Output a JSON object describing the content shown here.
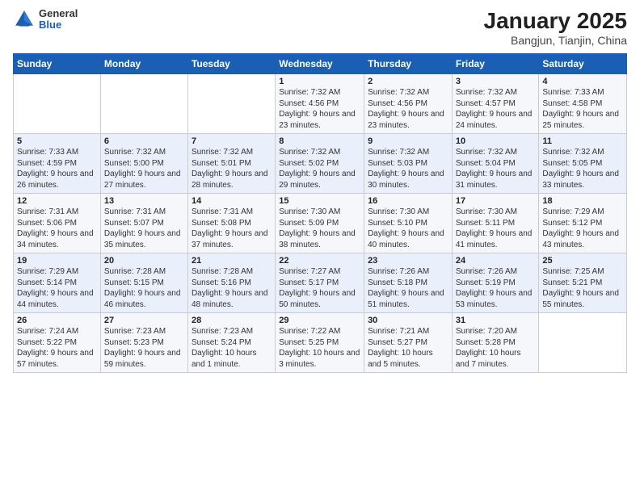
{
  "header": {
    "logo_general": "General",
    "logo_blue": "Blue",
    "title": "January 2025",
    "subtitle": "Bangjun, Tianjin, China"
  },
  "weekdays": [
    "Sunday",
    "Monday",
    "Tuesday",
    "Wednesday",
    "Thursday",
    "Friday",
    "Saturday"
  ],
  "weeks": [
    [
      {
        "day": "",
        "info": ""
      },
      {
        "day": "",
        "info": ""
      },
      {
        "day": "",
        "info": ""
      },
      {
        "day": "1",
        "info": "Sunrise: 7:32 AM\nSunset: 4:56 PM\nDaylight: 9 hours and 23 minutes."
      },
      {
        "day": "2",
        "info": "Sunrise: 7:32 AM\nSunset: 4:56 PM\nDaylight: 9 hours and 23 minutes."
      },
      {
        "day": "3",
        "info": "Sunrise: 7:32 AM\nSunset: 4:57 PM\nDaylight: 9 hours and 24 minutes."
      },
      {
        "day": "4",
        "info": "Sunrise: 7:33 AM\nSunset: 4:58 PM\nDaylight: 9 hours and 25 minutes."
      }
    ],
    [
      {
        "day": "5",
        "info": "Sunrise: 7:33 AM\nSunset: 4:59 PM\nDaylight: 9 hours and 26 minutes."
      },
      {
        "day": "6",
        "info": "Sunrise: 7:32 AM\nSunset: 5:00 PM\nDaylight: 9 hours and 27 minutes."
      },
      {
        "day": "7",
        "info": "Sunrise: 7:32 AM\nSunset: 5:01 PM\nDaylight: 9 hours and 28 minutes."
      },
      {
        "day": "8",
        "info": "Sunrise: 7:32 AM\nSunset: 5:02 PM\nDaylight: 9 hours and 29 minutes."
      },
      {
        "day": "9",
        "info": "Sunrise: 7:32 AM\nSunset: 5:03 PM\nDaylight: 9 hours and 30 minutes."
      },
      {
        "day": "10",
        "info": "Sunrise: 7:32 AM\nSunset: 5:04 PM\nDaylight: 9 hours and 31 minutes."
      },
      {
        "day": "11",
        "info": "Sunrise: 7:32 AM\nSunset: 5:05 PM\nDaylight: 9 hours and 33 minutes."
      }
    ],
    [
      {
        "day": "12",
        "info": "Sunrise: 7:31 AM\nSunset: 5:06 PM\nDaylight: 9 hours and 34 minutes."
      },
      {
        "day": "13",
        "info": "Sunrise: 7:31 AM\nSunset: 5:07 PM\nDaylight: 9 hours and 35 minutes."
      },
      {
        "day": "14",
        "info": "Sunrise: 7:31 AM\nSunset: 5:08 PM\nDaylight: 9 hours and 37 minutes."
      },
      {
        "day": "15",
        "info": "Sunrise: 7:30 AM\nSunset: 5:09 PM\nDaylight: 9 hours and 38 minutes."
      },
      {
        "day": "16",
        "info": "Sunrise: 7:30 AM\nSunset: 5:10 PM\nDaylight: 9 hours and 40 minutes."
      },
      {
        "day": "17",
        "info": "Sunrise: 7:30 AM\nSunset: 5:11 PM\nDaylight: 9 hours and 41 minutes."
      },
      {
        "day": "18",
        "info": "Sunrise: 7:29 AM\nSunset: 5:12 PM\nDaylight: 9 hours and 43 minutes."
      }
    ],
    [
      {
        "day": "19",
        "info": "Sunrise: 7:29 AM\nSunset: 5:14 PM\nDaylight: 9 hours and 44 minutes."
      },
      {
        "day": "20",
        "info": "Sunrise: 7:28 AM\nSunset: 5:15 PM\nDaylight: 9 hours and 46 minutes."
      },
      {
        "day": "21",
        "info": "Sunrise: 7:28 AM\nSunset: 5:16 PM\nDaylight: 9 hours and 48 minutes."
      },
      {
        "day": "22",
        "info": "Sunrise: 7:27 AM\nSunset: 5:17 PM\nDaylight: 9 hours and 50 minutes."
      },
      {
        "day": "23",
        "info": "Sunrise: 7:26 AM\nSunset: 5:18 PM\nDaylight: 9 hours and 51 minutes."
      },
      {
        "day": "24",
        "info": "Sunrise: 7:26 AM\nSunset: 5:19 PM\nDaylight: 9 hours and 53 minutes."
      },
      {
        "day": "25",
        "info": "Sunrise: 7:25 AM\nSunset: 5:21 PM\nDaylight: 9 hours and 55 minutes."
      }
    ],
    [
      {
        "day": "26",
        "info": "Sunrise: 7:24 AM\nSunset: 5:22 PM\nDaylight: 9 hours and 57 minutes."
      },
      {
        "day": "27",
        "info": "Sunrise: 7:23 AM\nSunset: 5:23 PM\nDaylight: 9 hours and 59 minutes."
      },
      {
        "day": "28",
        "info": "Sunrise: 7:23 AM\nSunset: 5:24 PM\nDaylight: 10 hours and 1 minute."
      },
      {
        "day": "29",
        "info": "Sunrise: 7:22 AM\nSunset: 5:25 PM\nDaylight: 10 hours and 3 minutes."
      },
      {
        "day": "30",
        "info": "Sunrise: 7:21 AM\nSunset: 5:27 PM\nDaylight: 10 hours and 5 minutes."
      },
      {
        "day": "31",
        "info": "Sunrise: 7:20 AM\nSunset: 5:28 PM\nDaylight: 10 hours and 7 minutes."
      },
      {
        "day": "",
        "info": ""
      }
    ]
  ]
}
